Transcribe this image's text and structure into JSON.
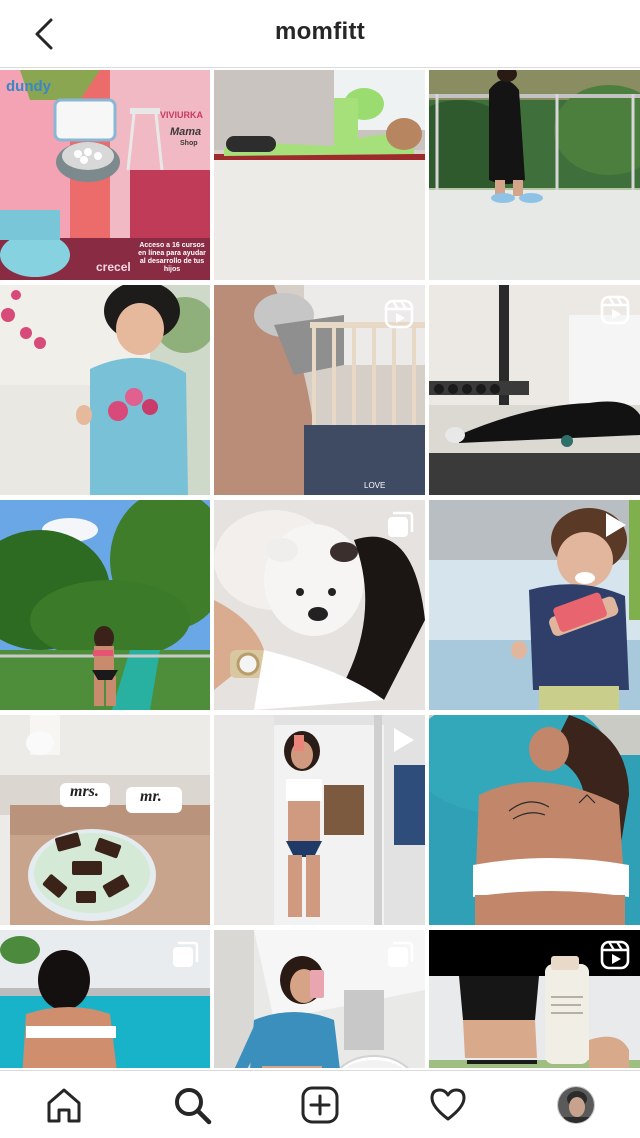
{
  "header": {
    "title": "momfitt",
    "back_icon": "chevron-left-icon"
  },
  "grid": {
    "tiles": [
      {
        "id": "ad-banner",
        "badge": "none",
        "texts": {
          "brand1": "dundy",
          "brand2": "VIVIURKA",
          "brand3": "Mama",
          "brand3b": "Shop",
          "brand4": "crecel",
          "caption": "Acceso a 16 cursos en línea para ayudar al desarrollo de tus hijos"
        }
      },
      {
        "id": "floor-workout",
        "badge": "none"
      },
      {
        "id": "balcony-pose",
        "badge": "none"
      },
      {
        "id": "toddler-flowers",
        "badge": "none"
      },
      {
        "id": "crib-selfie",
        "badge": "reel",
        "texts": {
          "corner": "LOVE"
        }
      },
      {
        "id": "gym-plank",
        "badge": "reel"
      },
      {
        "id": "jungle-pool",
        "badge": "none"
      },
      {
        "id": "bulldog-puppy",
        "badge": "carousel"
      },
      {
        "id": "laughing-toddler",
        "badge": "video"
      },
      {
        "id": "mint-dessert-bed",
        "badge": "none",
        "texts": {
          "pillow1": "mrs.",
          "pillow2": "mr."
        }
      },
      {
        "id": "mirror-selfie",
        "badge": "video"
      },
      {
        "id": "poolside-back",
        "badge": "none"
      },
      {
        "id": "pool-edge",
        "badge": "carousel"
      },
      {
        "id": "bathroom-selfie",
        "badge": "carousel"
      },
      {
        "id": "abs-product",
        "badge": "reel"
      }
    ]
  },
  "tabbar": {
    "items": [
      "home-icon",
      "search-icon",
      "new-post-icon",
      "heart-icon",
      "profile-avatar"
    ]
  },
  "colors": {
    "text": "#262626",
    "divider": "#dbdbdb",
    "background": "#ffffff"
  }
}
